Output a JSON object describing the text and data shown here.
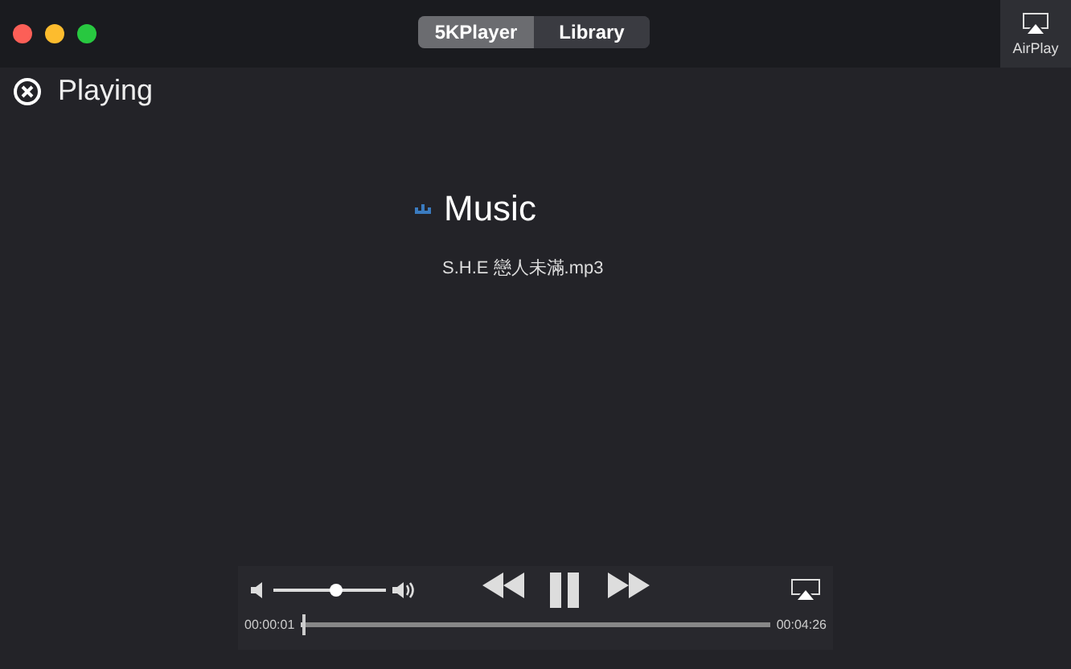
{
  "window": {
    "tabs": [
      {
        "label": "5KPlayer",
        "selected": true
      },
      {
        "label": "Library",
        "selected": false
      }
    ],
    "airplay_label": "AirPlay"
  },
  "header": {
    "title": "Playing"
  },
  "now_playing": {
    "category": "Music",
    "file": "S.H.E 戀人未滿.mp3"
  },
  "controls": {
    "volume": {
      "level": 0.55
    },
    "progress": {
      "level": 0.003
    },
    "elapsed": "00:00:01",
    "duration": "00:04:26"
  }
}
